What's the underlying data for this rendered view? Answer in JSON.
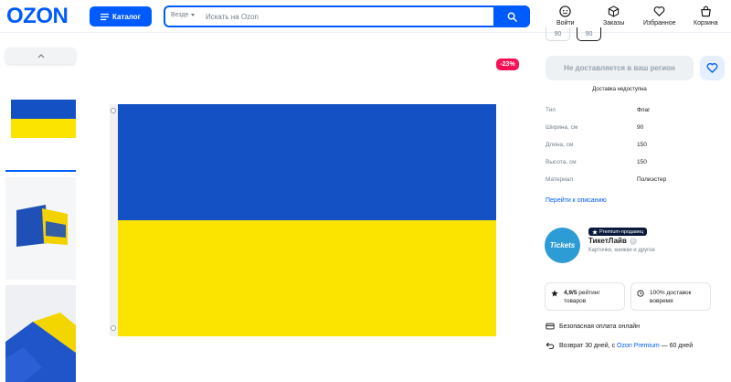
{
  "header": {
    "logo": "OZON",
    "catalog_label": "Каталог",
    "search_scope": "Везде",
    "search_placeholder": "Искать на Ozon",
    "nav": [
      {
        "label": "Войти",
        "icon": "user-icon"
      },
      {
        "label": "Заказы",
        "icon": "box-icon"
      },
      {
        "label": "Избранное",
        "icon": "heart-icon"
      },
      {
        "label": "Корзина",
        "icon": "cart-icon"
      }
    ]
  },
  "gallery": {
    "up_icon": "chevron-up-icon",
    "discount": "-23%"
  },
  "product": {
    "sizes": [
      "90",
      "90"
    ],
    "not_deliverable": "Не доставляется в ваш регион",
    "delivery_note": "Доставка недоступна",
    "specs": [
      {
        "key": "Тип",
        "value": "Флаг"
      },
      {
        "key": "Ширина, см",
        "value": "90"
      },
      {
        "key": "Длина, см",
        "value": "150"
      },
      {
        "key": "Высота, см",
        "value": "150"
      },
      {
        "key": "Материал",
        "value": "Полиэстер"
      }
    ],
    "to_description": "Перейти к описанию"
  },
  "seller": {
    "logo_text": "Tickets",
    "badge": "Premium-продавец",
    "name": "ТикетЛайв",
    "info_mark": "i",
    "subtitle": "Карточки, книжки и другое",
    "rating_value": "4,9/5",
    "rating_label": "рейтинг товаров",
    "delivery_value": "100%",
    "delivery_label": "доставок вовремя"
  },
  "perks": {
    "payment": "Безопасная оплата онлайн",
    "return_prefix": "Возврат 30 дней, с",
    "return_link": "Ozon Premium",
    "return_suffix": "— 60 дней"
  },
  "colors": {
    "brand": "#005bff",
    "discount": "#f91155",
    "flag_blue": "#1351c5",
    "flag_yellow": "#fbe400"
  }
}
